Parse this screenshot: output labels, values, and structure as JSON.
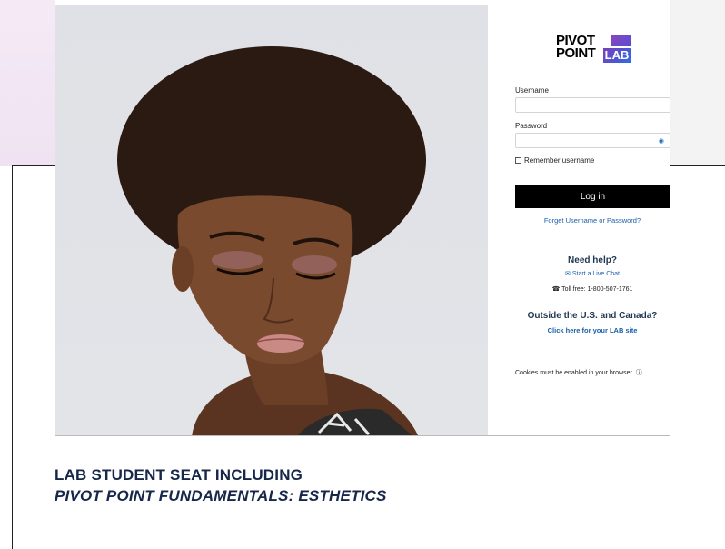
{
  "logo": {
    "line1": "PIVOT",
    "line2": "POINT",
    "badge": "LAB"
  },
  "form": {
    "username_label": "Username",
    "username_value": "",
    "password_label": "Password",
    "password_value": "",
    "remember_label": "Remember username",
    "login_button": "Log in",
    "forgot_link": "Forget Username or Password?"
  },
  "help": {
    "title": "Need help?",
    "live_chat": "Start a Live Chat",
    "toll_free": "Toll free: 1-800-507-1761",
    "outside_title": "Outside the U.S. and Canada?",
    "lab_site_link": "Click here for your LAB site"
  },
  "cookies_notice": "Cookies must be enabled in your browser",
  "caption": {
    "line1": "LAB STUDENT SEAT INCLUDING",
    "line2": "PIVOT POINT FUNDAMENTALS: ESTHETICS"
  },
  "colors": {
    "accent_link": "#1a5fa8",
    "heading_navy": "#1f3550",
    "caption_navy": "#16274a",
    "lab_gradient_start": "#7a3fb8",
    "lab_gradient_end": "#2f6fe0"
  },
  "icons": [
    "eye-icon",
    "chat-icon",
    "phone-icon",
    "help-circle-icon"
  ]
}
